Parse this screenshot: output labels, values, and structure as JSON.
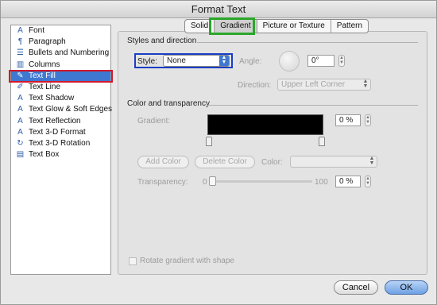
{
  "window": {
    "title": "Format Text"
  },
  "sidebar": {
    "items": [
      {
        "label": "Font",
        "icon": "font-icon"
      },
      {
        "label": "Paragraph",
        "icon": "paragraph-icon"
      },
      {
        "label": "Bullets and Numbering",
        "icon": "bullets-icon"
      },
      {
        "label": "Columns",
        "icon": "columns-icon"
      },
      {
        "label": "Text Fill",
        "icon": "text-fill-icon",
        "selected": true
      },
      {
        "label": "Text Line",
        "icon": "text-line-icon"
      },
      {
        "label": "Text Shadow",
        "icon": "text-shadow-icon"
      },
      {
        "label": "Text Glow & Soft Edges",
        "icon": "text-glow-icon"
      },
      {
        "label": "Text Reflection",
        "icon": "text-reflection-icon"
      },
      {
        "label": "Text 3-D Format",
        "icon": "text-3d-format-icon"
      },
      {
        "label": "Text 3-D Rotation",
        "icon": "text-3d-rotation-icon"
      },
      {
        "label": "Text Box",
        "icon": "text-box-icon"
      }
    ]
  },
  "tabs": [
    {
      "label": "Solid"
    },
    {
      "label": "Gradient",
      "active": true
    },
    {
      "label": "Picture or Texture"
    },
    {
      "label": "Pattern"
    }
  ],
  "styles": {
    "heading": "Styles and direction",
    "style_label": "Style:",
    "style_value": "None",
    "angle_label": "Angle:",
    "angle_value": "0°",
    "direction_label": "Direction:",
    "direction_value": "Upper Left Corner"
  },
  "color": {
    "heading": "Color and transparency",
    "gradient_label": "Gradient:",
    "gradient_percent": "0 %",
    "add_color_label": "Add Color",
    "delete_color_label": "Delete Color",
    "color_label": "Color:",
    "transparency_label": "Transparency:",
    "slider_min": "0",
    "slider_max": "100",
    "transparency_value": "0 %",
    "rotate_label": "Rotate gradient with shape"
  },
  "footer": {
    "cancel_label": "Cancel",
    "ok_label": "OK"
  },
  "annotation_colors": {
    "sidebar_highlight": "#d2182a",
    "tab_highlight": "#2aa62a",
    "style_highlight": "#1a3ec4"
  }
}
